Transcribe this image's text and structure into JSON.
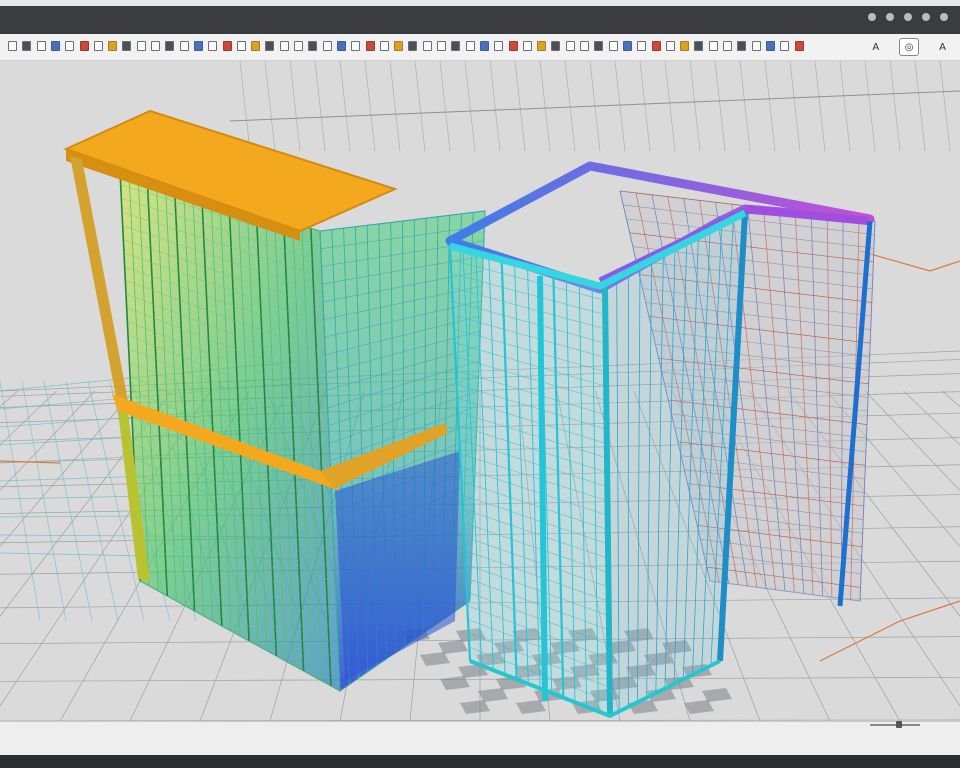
{
  "menubar": {
    "items": [],
    "right_icons": [
      "shield-icon",
      "cloud-icon",
      "star-icon",
      "bell-icon",
      "user-icon"
    ]
  },
  "toolbar": {
    "icon_count": 56,
    "right": {
      "label_a": "A",
      "label_b": "A"
    }
  },
  "statusbar": {
    "text": ""
  },
  "colors": {
    "accent_orange": "#f4a81d",
    "green_mesh": "#5fd35a",
    "blue_mesh": "#2a55d6",
    "cyan_frame": "#22c6d8",
    "purple_frame": "#a04de0",
    "viewport_bg": "#d9dad9"
  }
}
